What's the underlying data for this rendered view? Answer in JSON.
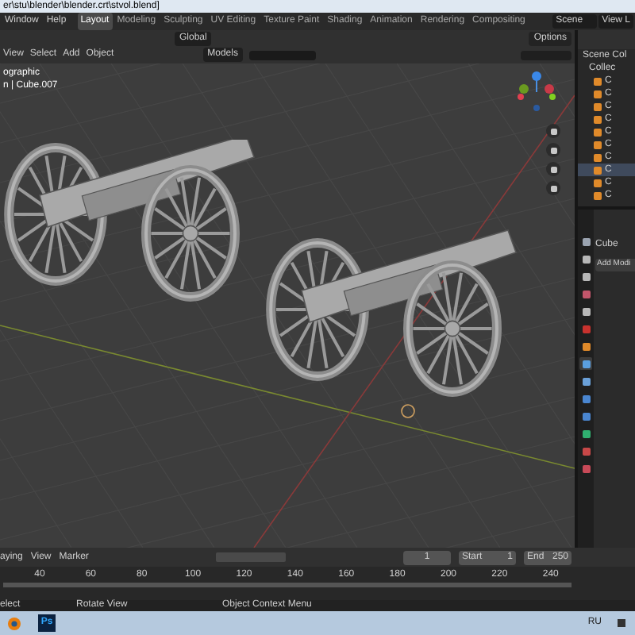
{
  "title_bar": {
    "title": "er\\stu\\blender\\blender.crt\\stvol.blend]"
  },
  "menu": [
    "Window",
    "Help"
  ],
  "workspaces": [
    {
      "label": "Layout",
      "selected": true
    },
    {
      "label": "Modeling",
      "selected": false
    },
    {
      "label": "Sculpting",
      "selected": false
    },
    {
      "label": "UV Editing",
      "selected": false
    },
    {
      "label": "Texture Paint",
      "selected": false
    },
    {
      "label": "Shading",
      "selected": false
    },
    {
      "label": "Animation",
      "selected": false
    },
    {
      "label": "Rendering",
      "selected": false
    },
    {
      "label": "Compositing",
      "selected": false
    }
  ],
  "scene": {
    "value": "Scene"
  },
  "view_layer": {
    "value": "View L"
  },
  "header": {
    "orientation": "Global",
    "options": "Options"
  },
  "viewport_menu": [
    "View",
    "Select",
    "Add",
    "Object"
  ],
  "collection_dropdown": {
    "value": "Models"
  },
  "viewport_overlay": [
    "ographic",
    "n | Cube.007"
  ],
  "outliner": {
    "root": "Scene Col",
    "collection": "Collec",
    "items": [
      {
        "name": "C",
        "selected": false
      },
      {
        "name": "C",
        "selected": false
      },
      {
        "name": "C",
        "selected": false
      },
      {
        "name": "C",
        "selected": false
      },
      {
        "name": "C",
        "selected": false
      },
      {
        "name": "C",
        "selected": false
      },
      {
        "name": "C",
        "selected": false
      },
      {
        "name": "C",
        "selected": true
      },
      {
        "name": "C",
        "selected": false
      },
      {
        "name": "C",
        "selected": false
      }
    ]
  },
  "properties": {
    "object": "Cube",
    "button": "Add Modi",
    "tabs": [
      {
        "kind": "tool",
        "selected": false
      },
      {
        "kind": "render",
        "selected": false
      },
      {
        "kind": "output",
        "selected": false
      },
      {
        "kind": "view",
        "selected": false
      },
      {
        "kind": "scene",
        "selected": false
      },
      {
        "kind": "world",
        "selected": false
      },
      {
        "kind": "object",
        "selected": false
      },
      {
        "kind": "modifier",
        "selected": true
      },
      {
        "kind": "particles",
        "selected": false
      },
      {
        "kind": "physics",
        "selected": false
      },
      {
        "kind": "constraints",
        "selected": false
      },
      {
        "kind": "data",
        "selected": false
      },
      {
        "kind": "material",
        "selected": false
      },
      {
        "kind": "texture",
        "selected": false
      }
    ]
  },
  "timeline": {
    "mode": "aying",
    "menus": [
      "View",
      "Marker"
    ],
    "current_frame": "1",
    "start_label": "Start",
    "start": "1",
    "end_label": "End",
    "end": "250",
    "ticks": [
      "40",
      "60",
      "80",
      "100",
      "120",
      "140",
      "160",
      "180",
      "200",
      "220",
      "240"
    ]
  },
  "status_bar": [
    "elect",
    "Rotate View",
    "Object Context Menu"
  ],
  "taskbar": {
    "apps": [
      {
        "kind": "blender"
      },
      {
        "kind": "photoshop",
        "label": "Ps"
      }
    ],
    "tray": "RU"
  }
}
